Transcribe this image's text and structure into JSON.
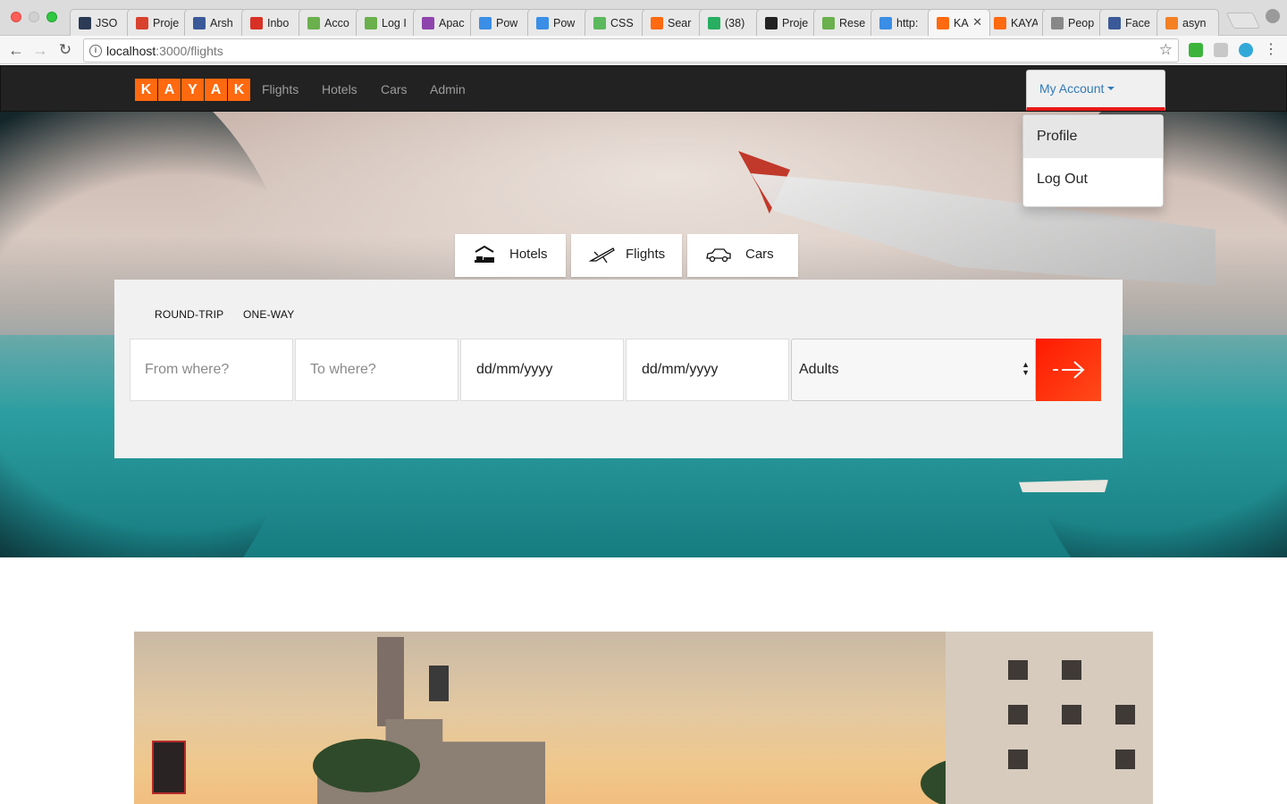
{
  "browser": {
    "tabs": [
      {
        "label": "JSO",
        "favicon": "json-icon",
        "color": "#2b3a55"
      },
      {
        "label": "Proje",
        "favicon": "lifebuoy-icon",
        "color": "#d9412f"
      },
      {
        "label": "Arsh",
        "favicon": "facebook-icon",
        "color": "#3b5998"
      },
      {
        "label": "Inbo",
        "favicon": "gmail-icon",
        "color": "#d93025"
      },
      {
        "label": "Acco",
        "favicon": "recycle-icon",
        "color": "#6ab04c"
      },
      {
        "label": "Log I",
        "favicon": "recycle-icon",
        "color": "#6ab04c"
      },
      {
        "label": "Apac",
        "favicon": "feather-icon",
        "color": "#8e44ad"
      },
      {
        "label": "Pow",
        "favicon": "p-icon",
        "color": "#3a8ee6"
      },
      {
        "label": "Pow",
        "favicon": "p-icon",
        "color": "#3a8ee6"
      },
      {
        "label": "CSS",
        "favicon": "css-icon",
        "color": "#5cb85c"
      },
      {
        "label": "Sear",
        "favicon": "kayak-icon",
        "color": "#ff690f"
      },
      {
        "label": "(38)",
        "favicon": "counter-icon",
        "color": "#27ae60"
      },
      {
        "label": "Proje",
        "favicon": "github-icon",
        "color": "#222222"
      },
      {
        "label": "Rese",
        "favicon": "recycle-icon",
        "color": "#6ab04c"
      },
      {
        "label": "http:",
        "favicon": "p-icon",
        "color": "#3a8ee6"
      },
      {
        "label": "KA",
        "favicon": "kayak-icon",
        "color": "#ff690f",
        "active": true
      },
      {
        "label": "KAYA",
        "favicon": "kayak-icon",
        "color": "#ff690f"
      },
      {
        "label": "Peop",
        "favicon": "document-icon",
        "color": "#888888"
      },
      {
        "label": "Face",
        "favicon": "facebook-icon",
        "color": "#3b5998"
      },
      {
        "label": "asyn",
        "favicon": "stackoverflow-icon",
        "color": "#f48024"
      }
    ],
    "url_host": "localhost",
    "url_path": ":3000/flights"
  },
  "navbar": {
    "logo_letters": [
      "K",
      "A",
      "Y",
      "A",
      "K"
    ],
    "links": [
      "Flights",
      "Hotels",
      "Cars",
      "Admin"
    ],
    "account_label": "My Account"
  },
  "dropdown": {
    "items": [
      "Profile",
      "Log Out"
    ]
  },
  "search": {
    "type_tabs": [
      {
        "label": "Hotels",
        "icon": "hotel-bed-icon"
      },
      {
        "label": "Flights",
        "icon": "airplane-icon"
      },
      {
        "label": "Cars",
        "icon": "car-icon"
      }
    ],
    "trip_options": [
      "ROUND-TRIP",
      "ONE-WAY"
    ],
    "from_placeholder": "From where?",
    "to_placeholder": "To where?",
    "depart_value": "dd/mm/yyyy",
    "return_value": "dd/mm/yyyy",
    "travelers_value": "Adults",
    "submit_icon": "arrow-right-icon"
  },
  "colors": {
    "brand": "#ff690f",
    "accent": "#e8191a",
    "link": "#337ab7"
  }
}
